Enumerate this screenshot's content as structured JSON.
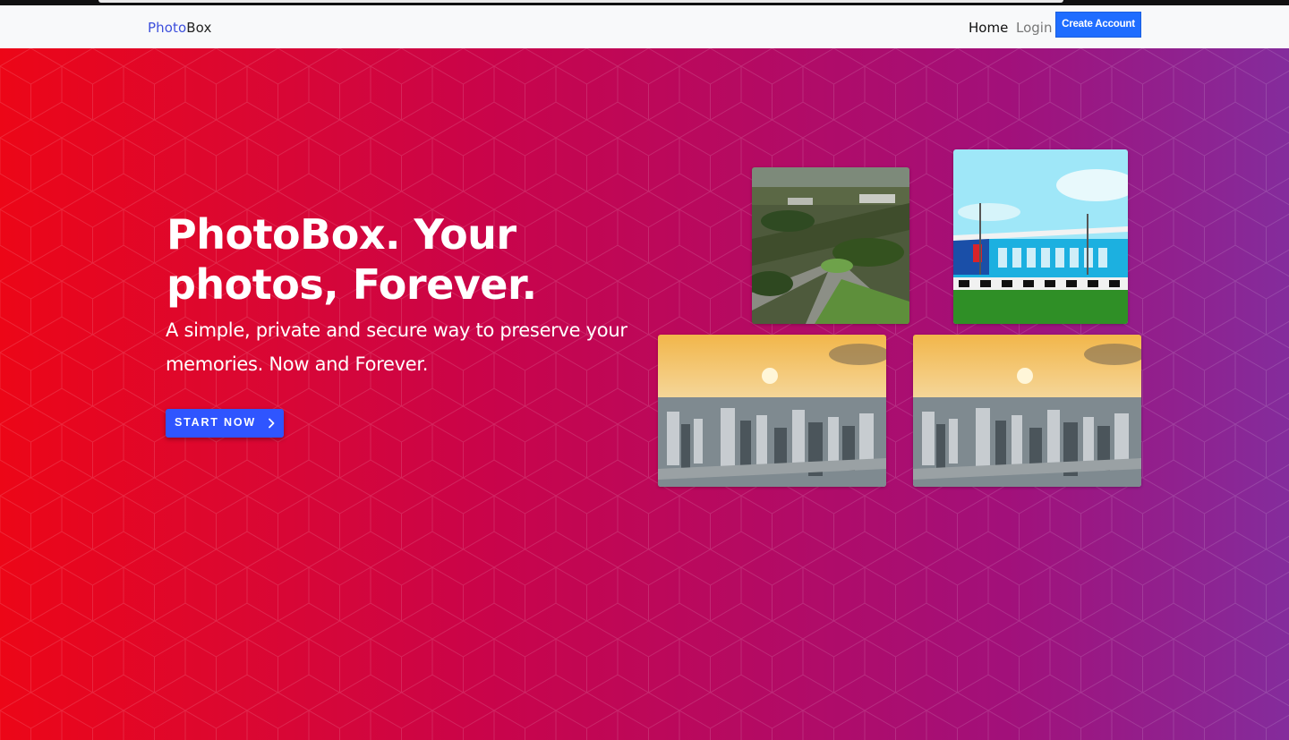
{
  "nav": {
    "brand_accent": "Photo",
    "brand_rest": "Box",
    "links": [
      "Home",
      "Login"
    ],
    "cta_label": "Create Account"
  },
  "hero": {
    "headline": "PhotoBox. Your photos, Forever.",
    "subheadline": "A simple, private and secure way to preserve your memories. Now and Forever.",
    "cta_label": "START NOW",
    "cta_icon": "chevron-right-icon"
  },
  "colors": {
    "brand_accent": "#3d4fdc",
    "nav_cta": "#1f6dff",
    "hero_start_button": "#2f55ff",
    "hero_gradient_start": "#ec0617",
    "hero_gradient_end": "#842c9c"
  },
  "gallery": [
    {
      "name": "aerial-campus-photo"
    },
    {
      "name": "blue-building-photo"
    },
    {
      "name": "city-sunset-photo"
    },
    {
      "name": "city-sunset-photo"
    }
  ]
}
